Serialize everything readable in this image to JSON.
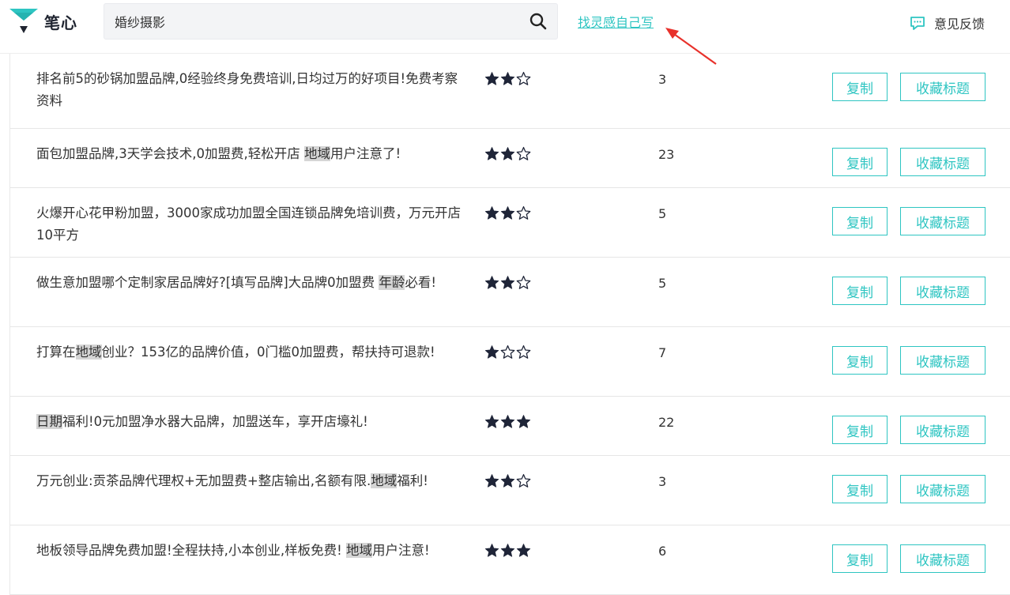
{
  "header": {
    "logo_text": "笔心",
    "search_value": "婚纱摄影",
    "inspire_link": "找灵感自己写",
    "feedback_label": "意见反馈"
  },
  "colors": {
    "accent": "#2ec5c2",
    "arrow": "#e8312b",
    "star": "#1f2538",
    "highlight": "#d5d5d5"
  },
  "list": {
    "copy_label": "复制",
    "fav_label": "收藏标题",
    "rows": [
      {
        "segments": [
          {
            "t": "排名前5的砂锅加盟品牌,0经验终身免费培训,日均过万的好项目!免费考察资料",
            "hl": false
          }
        ],
        "rating": 2,
        "count": "3"
      },
      {
        "segments": [
          {
            "t": "面包加盟品牌,3天学会技术,0加盟费,轻松开店 ",
            "hl": false
          },
          {
            "t": "地域",
            "hl": true
          },
          {
            "t": "用户注意了!",
            "hl": false
          }
        ],
        "rating": 2,
        "count": "23"
      },
      {
        "segments": [
          {
            "t": "火爆开心花甲粉加盟，3000家成功加盟全国连锁品牌免培训费，万元开店10平方",
            "hl": false
          }
        ],
        "rating": 2,
        "count": "5"
      },
      {
        "segments": [
          {
            "t": "做生意加盟哪个定制家居品牌好?[填写品牌]大品牌0加盟费 ",
            "hl": false
          },
          {
            "t": "年龄",
            "hl": true
          },
          {
            "t": "必看!",
            "hl": false
          }
        ],
        "rating": 2,
        "count": "5"
      },
      {
        "segments": [
          {
            "t": "打算在",
            "hl": false
          },
          {
            "t": "地域",
            "hl": true
          },
          {
            "t": "创业？153亿的品牌价值，0门槛0加盟费，帮扶持可退款!",
            "hl": false
          }
        ],
        "rating": 1,
        "count": "7"
      },
      {
        "segments": [
          {
            "t": "日期",
            "hl": true
          },
          {
            "t": "福利!0元加盟净水器大品牌，加盟送车，享开店壕礼!",
            "hl": false
          }
        ],
        "rating": 3,
        "count": "22"
      },
      {
        "segments": [
          {
            "t": "万元创业:贡茶品牌代理权+无加盟费+整店输出,名额有限.",
            "hl": false
          },
          {
            "t": "地域",
            "hl": true
          },
          {
            "t": "福利!",
            "hl": false
          }
        ],
        "rating": 2,
        "count": "3"
      },
      {
        "segments": [
          {
            "t": "地板领导品牌免费加盟!全程扶持,小本创业,样板免费! ",
            "hl": false
          },
          {
            "t": "地域",
            "hl": true
          },
          {
            "t": "用户注意!",
            "hl": false
          }
        ],
        "rating": 3,
        "count": "6"
      }
    ]
  }
}
